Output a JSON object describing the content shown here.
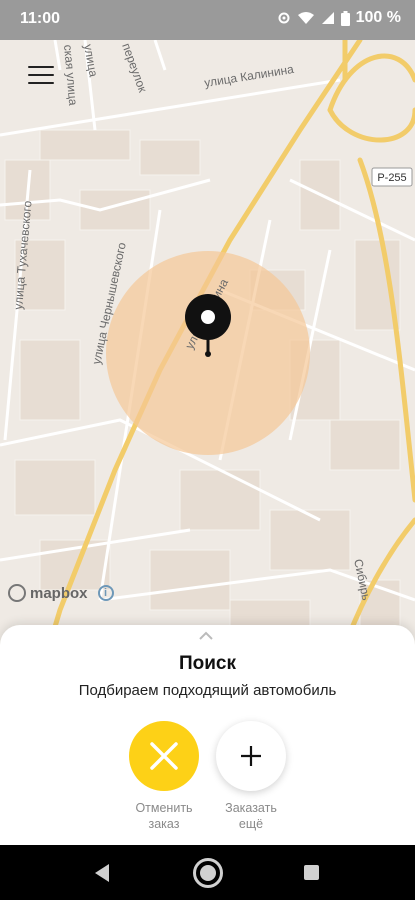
{
  "status_bar": {
    "time": "11:00",
    "battery": "100 %"
  },
  "map": {
    "streets": [
      "улица Калинина",
      "улица Тухачевского",
      "улица Чернышевского",
      "Сибирь",
      "переулок",
      "улица",
      "ская улица",
      "улица Ленина"
    ],
    "road_sign": "Р-255",
    "attribution": "mapbox",
    "colors": {
      "road": "#f2cc6a",
      "search_area": "#f5c897",
      "marker": "#111111"
    }
  },
  "sheet": {
    "title": "Поиск",
    "subtitle": "Подбираем подходящий автомобиль",
    "cancel": {
      "line1": "Отменить",
      "line2": "заказ"
    },
    "more": {
      "line1": "Заказать",
      "line2": "ещё"
    }
  }
}
